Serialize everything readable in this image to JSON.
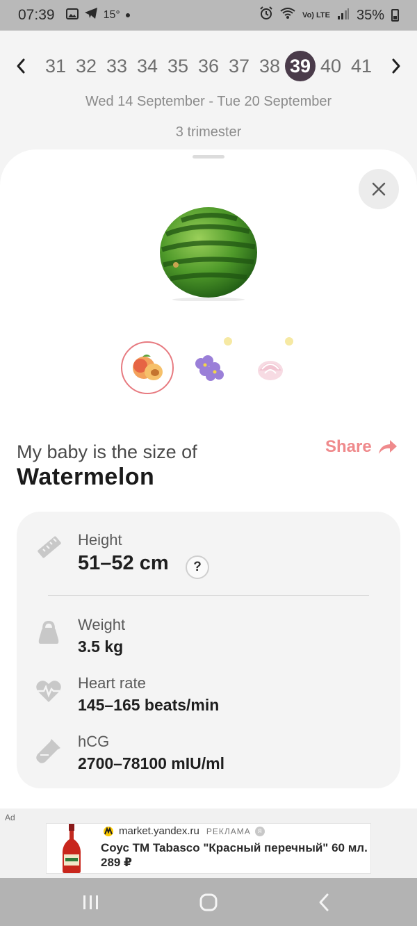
{
  "status_bar": {
    "time": "07:39",
    "temperature": "15°",
    "network": "Vo) LTE",
    "battery": "35%"
  },
  "weeks": {
    "items": [
      "31",
      "32",
      "33",
      "34",
      "35",
      "36",
      "37",
      "38",
      "39",
      "40",
      "41"
    ],
    "selected": "39",
    "prev_label": "‹",
    "next_label": "›"
  },
  "date_range": "Wed 14 September - Tue 20 September",
  "trimester": "3 trimester",
  "sheet": {
    "close_label": "✕",
    "main_image_icon": "watermelon-image",
    "thumbnails": [
      "peach",
      "violet-flower",
      "meringue"
    ],
    "size_label": "My baby is the size of",
    "fruit_name": "Watermelon",
    "share_label": "Share"
  },
  "stats": {
    "height": {
      "label": "Height",
      "value": "51–52 cm",
      "help": "?"
    },
    "weight": {
      "label": "Weight",
      "value": "3.5 kg"
    },
    "heart_rate": {
      "label": "Heart rate",
      "value": "145–165 beats/min"
    },
    "hcg": {
      "label": "hCG",
      "value": "2700–78100 mIU/ml"
    }
  },
  "ad": {
    "tag": "Ad",
    "source": "market.yandex.ru",
    "reklama": "РЕКЛАМА",
    "info": "я",
    "title": "Соус ТМ Tabasco \"Красный перечный\" 60 мл. 289 ₽"
  },
  "colors": {
    "accent": "#ef8a8c",
    "selected_week": "#4a3b4a"
  }
}
